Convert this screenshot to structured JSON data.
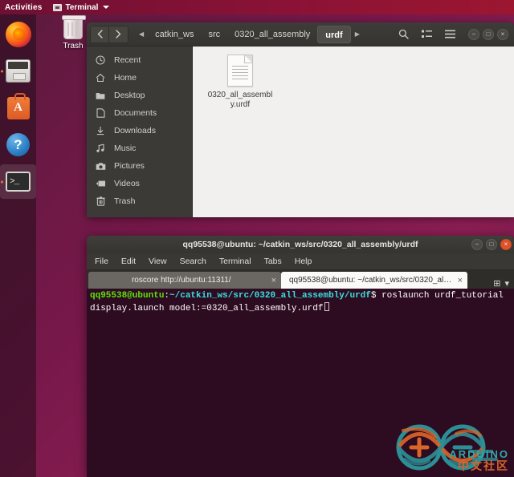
{
  "topbar": {
    "activities": "Activities",
    "app_name": "Terminal",
    "app_icon": "terminal-icon",
    "caret_icon": "chevron-down-icon"
  },
  "dock": {
    "items": [
      {
        "name": "firefox",
        "label": "Firefox Web Browser",
        "running": false
      },
      {
        "name": "files",
        "label": "Files",
        "running": true
      },
      {
        "name": "ubuntu-software",
        "label": "Ubuntu Software",
        "running": false
      },
      {
        "name": "help",
        "label": "Help",
        "running": false
      },
      {
        "name": "terminal",
        "label": "Terminal",
        "running": true
      }
    ]
  },
  "desktop": {
    "trash_label": "Trash"
  },
  "nautilus": {
    "nav": {
      "back_icon": "chevron-left-icon",
      "forward_icon": "chevron-right-icon"
    },
    "breadcrumb_overflow_icon": "chevron-left-small-icon",
    "breadcrumbs": [
      {
        "label": "catkin_ws",
        "active": false
      },
      {
        "label": "src",
        "active": false
      },
      {
        "label": "0320_all_assembly",
        "active": false
      },
      {
        "label": "urdf",
        "active": true
      }
    ],
    "breadcrumb_next_icon": "chevron-right-small-icon",
    "tools": [
      {
        "name": "search-icon",
        "label": "Search"
      },
      {
        "name": "view-list-icon",
        "label": "View options"
      },
      {
        "name": "hamburger-menu-icon",
        "label": "Menu"
      }
    ],
    "window_controls": [
      {
        "name": "minimize-button",
        "glyph": "−"
      },
      {
        "name": "maximize-button",
        "glyph": "□"
      },
      {
        "name": "close-button",
        "glyph": "×"
      }
    ],
    "sidebar": [
      {
        "label": "Recent",
        "icon": "clock-icon"
      },
      {
        "label": "Home",
        "icon": "home-icon"
      },
      {
        "label": "Desktop",
        "icon": "folder-icon"
      },
      {
        "label": "Documents",
        "icon": "document-icon"
      },
      {
        "label": "Downloads",
        "icon": "download-icon"
      },
      {
        "label": "Music",
        "icon": "music-icon"
      },
      {
        "label": "Pictures",
        "icon": "camera-icon"
      },
      {
        "label": "Videos",
        "icon": "video-icon"
      },
      {
        "label": "Trash",
        "icon": "trash-icon"
      }
    ],
    "files": [
      {
        "name": "0320_all_assembly.urdf",
        "display": "0320_all_assembly.urdf",
        "icon": "text-file-icon"
      }
    ]
  },
  "terminal": {
    "title": "qq95538@ubuntu: ~/catkin_ws/src/0320_all_assembly/urdf",
    "menu": [
      "File",
      "Edit",
      "View",
      "Search",
      "Terminal",
      "Tabs",
      "Help"
    ],
    "window_controls": [
      {
        "name": "minimize-button",
        "glyph": "−"
      },
      {
        "name": "maximize-button",
        "glyph": "□"
      },
      {
        "name": "close-button",
        "glyph": "×"
      }
    ],
    "tabs": [
      {
        "label": "roscore http://ubuntu:11311/",
        "active": false,
        "close_glyph": "×"
      },
      {
        "label": "qq95538@ubuntu: ~/catkin_ws/src/0320_all_a...",
        "active": true,
        "close_glyph": "×"
      }
    ],
    "tabs_right": [
      {
        "name": "new-tab-icon",
        "glyph": "⊞"
      },
      {
        "name": "tab-list-chevron-icon",
        "glyph": "▾"
      }
    ],
    "prompt": {
      "user_host": "qq95538@ubuntu",
      "separator": ":",
      "path": "~/catkin_ws/src/0320_all_assembly/urdf",
      "dollar": "$"
    },
    "command": " roslaunch urdf_tutorial display.launch model:=0320_all_assembly.urdf"
  },
  "watermark": {
    "en": "ARDUINO",
    "cn": "中文社区",
    "logo_icon": "arduino-infinity-logo-icon"
  },
  "colors": {
    "desktop": "#77184a",
    "topbar": "#8a1236",
    "terminal_bg": "#2d0b20",
    "prompt_green": "#5ee20b",
    "prompt_cyan": "#3ae0e0",
    "accent_orange": "#e0522a",
    "nautilus_chrome": "#3b3a37",
    "file_view_bg": "#f1f0ee"
  }
}
